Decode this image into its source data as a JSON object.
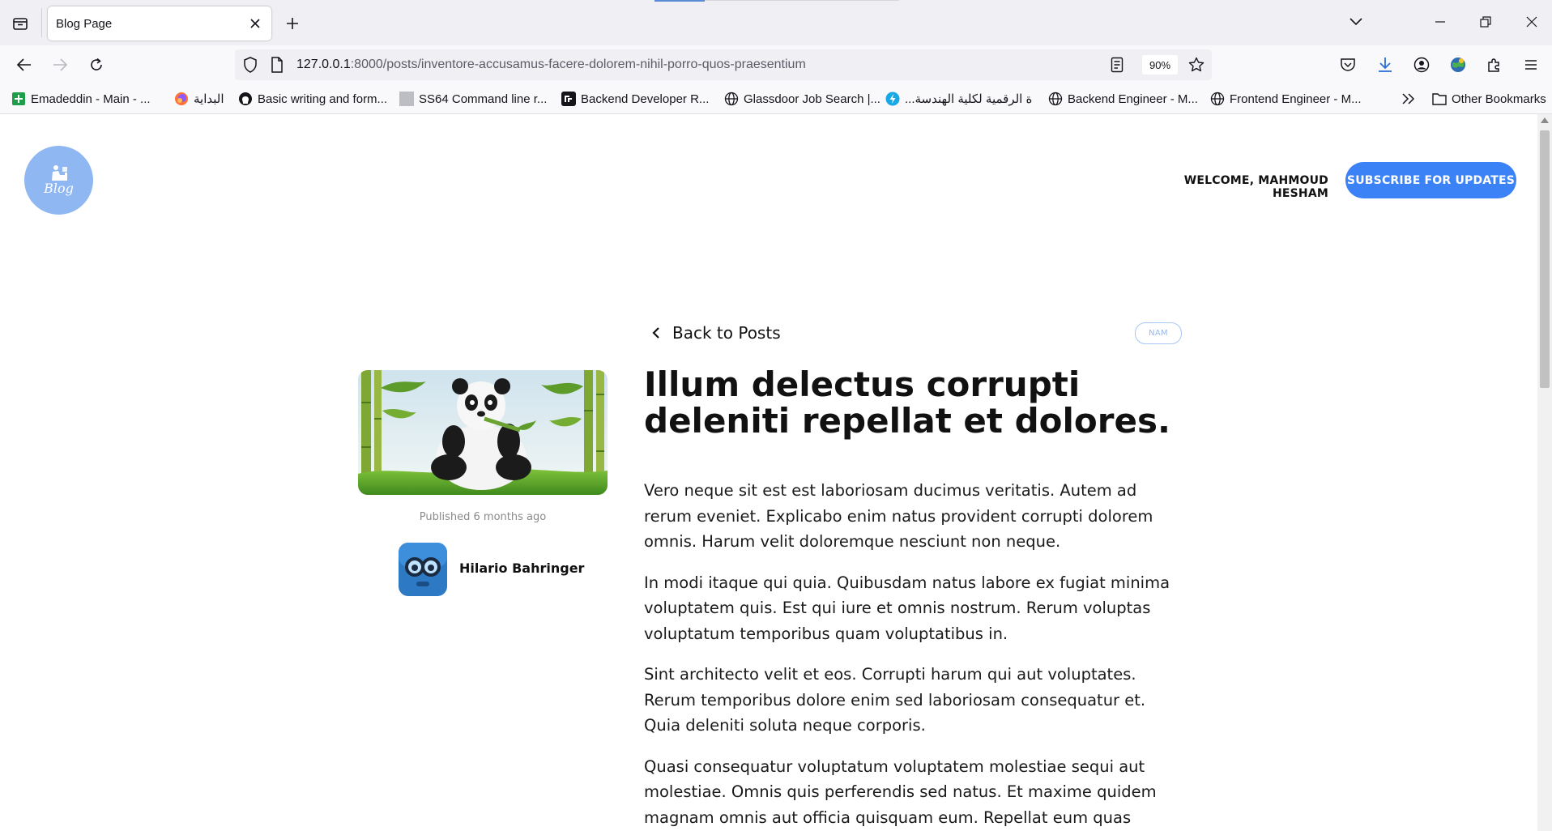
{
  "browser": {
    "tab_title": "Blog Page",
    "url_host": "127.0.0.1",
    "url_rest": ":8000/posts/inventore-accusamus-facere-dolorem-nihil-porro-quos-praesentium",
    "zoom": "90%",
    "bookmarks": [
      {
        "label": "Emadeddin - Main - ...",
        "icon": "green-sheet-icon"
      },
      {
        "label": "البداية",
        "icon": "firefox-icon"
      },
      {
        "label": "Basic writing and form...",
        "icon": "github-icon"
      },
      {
        "label": "SS64 Command line r...",
        "icon": "gray-square-icon"
      },
      {
        "label": "Backend Developer R...",
        "icon": "roadmap-icon"
      },
      {
        "label": "Glassdoor Job Search |...",
        "icon": "globe-icon"
      },
      {
        "label": "...ة الرقمية لكلية الهندسة",
        "icon": "bolt-icon"
      },
      {
        "label": "Backend Engineer - M...",
        "icon": "globe-icon"
      },
      {
        "label": "Frontend Engineer - M...",
        "icon": "globe-icon"
      }
    ],
    "other_bookmarks": "Other Bookmarks"
  },
  "site": {
    "logo_text": "Blog",
    "welcome": "WELCOME, MAHMOUD HESHAM",
    "subscribe": "SUBSCRIBE FOR UPDATES"
  },
  "post": {
    "back_label": "Back to Posts",
    "category": "NAM",
    "published": "Published 6 months ago",
    "author": "Hilario Bahringer",
    "title": "Illum delectus corrupti deleniti repellat et dolores.",
    "paragraphs": [
      "Vero neque sit est est laboriosam ducimus veritatis. Autem ad rerum eveniet. Explicabo enim natus provident corrupti dolorem omnis. Harum velit doloremque nesciunt non neque.",
      "In modi itaque qui quia. Quibusdam natus labore ex fugiat minima voluptatem quis. Est qui iure et omnis nostrum. Rerum voluptas voluptatum temporibus quam voluptatibus in.",
      "Sint architecto velit et eos. Corrupti harum qui aut voluptates. Rerum temporibus dolore enim sed laboriosam consequatur et. Quia deleniti soluta neque corporis.",
      "Quasi consequatur voluptatum voluptatem molestiae sequi aut molestiae. Omnis quis perferendis sed natus. Et maxime quidem magnam omnis aut officia quisquam eum. Repellat eum quas nemo"
    ]
  },
  "colors": {
    "accent": "#3b82f6",
    "logo_bg": "#8fb7f2",
    "badge_border": "#a9c6f5"
  }
}
